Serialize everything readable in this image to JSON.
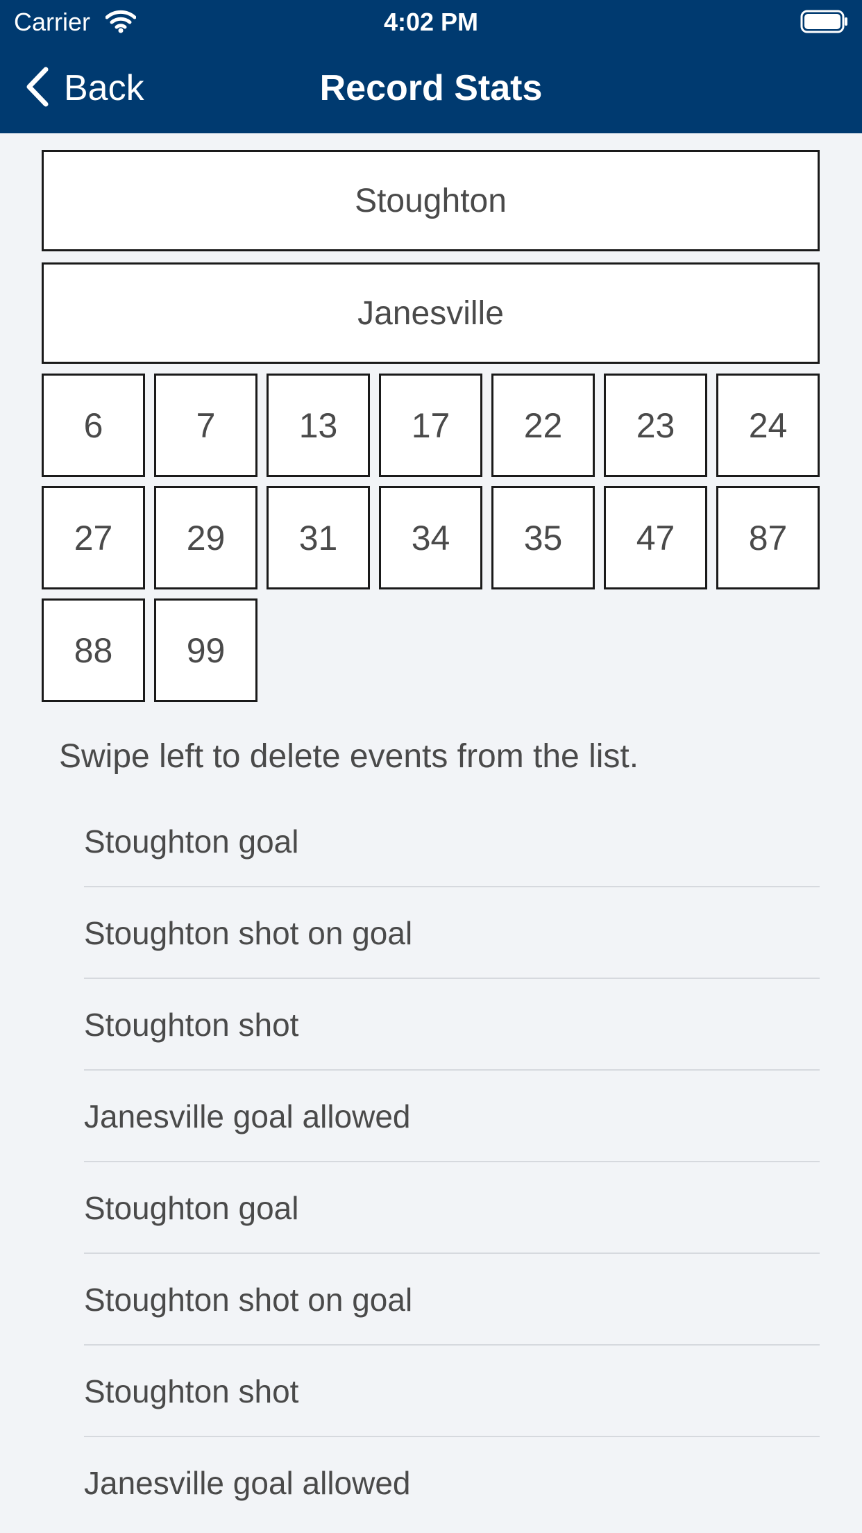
{
  "status": {
    "carrier": "Carrier",
    "time": "4:02 PM"
  },
  "nav": {
    "back_label": "Back",
    "title": "Record Stats"
  },
  "teams": [
    "Stoughton",
    "Janesville"
  ],
  "players": [
    "6",
    "7",
    "13",
    "17",
    "22",
    "23",
    "24",
    "27",
    "29",
    "31",
    "34",
    "35",
    "47",
    "87",
    "88",
    "99"
  ],
  "hint": "Swipe left to delete events from the list.",
  "events": [
    "Stoughton goal",
    "Stoughton shot on goal",
    "Stoughton shot",
    "Janesville goal allowed",
    "Stoughton goal",
    "Stoughton shot on goal",
    "Stoughton shot",
    "Janesville goal allowed"
  ],
  "colors": {
    "nav_background": "#003a70",
    "page_background": "#f2f4f7",
    "text": "#4a4a4a"
  }
}
